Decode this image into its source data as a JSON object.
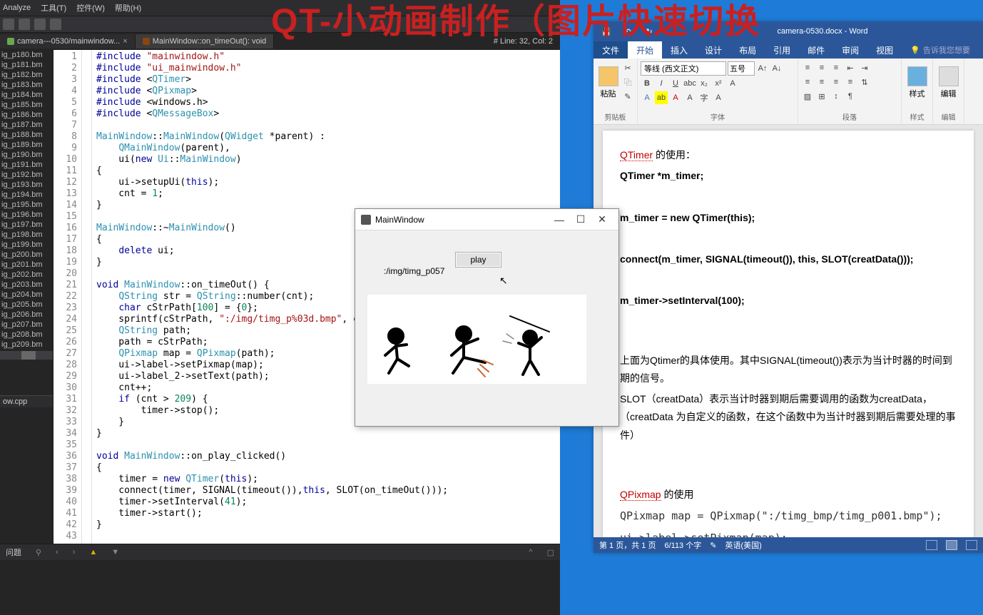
{
  "watermark": "QT-小动画制作（图片快速切换",
  "ide": {
    "menu": {
      "analyze": "Analyze",
      "tools": "工具(T)",
      "widgets": "控件(W)",
      "help": "帮助(H)"
    },
    "tabs": {
      "tab1": "camera---0530/mainwindow...",
      "tab2": "MainWindow::on_timeOut(): void",
      "status": "# Line: 32, Col: 2"
    },
    "sidebar_files": [
      "ig_p180.bm",
      "ig_p181.bm",
      "ig_p182.bm",
      "ig_p183.bm",
      "ig_p184.bm",
      "ig_p185.bm",
      "ig_p186.bm",
      "ig_p187.bm",
      "ig_p188.bm",
      "ig_p189.bm",
      "ig_p190.bm",
      "ig_p191.bm",
      "ig_p192.bm",
      "ig_p193.bm",
      "ig_p194.bm",
      "ig_p195.bm",
      "ig_p196.bm",
      "ig_p197.bm",
      "ig_p198.bm",
      "ig_p199.bm",
      "ig_p200.bm",
      "ig_p201.bm",
      "ig_p202.bm",
      "ig_p203.bm",
      "ig_p204.bm",
      "ig_p205.bm",
      "ig_p206.bm",
      "ig_p207.bm",
      "ig_p208.bm",
      "ig_p209.bm"
    ],
    "current_file": "ow.cpp",
    "code_lines": [
      {
        "n": 1,
        "t": "#include \"mainwindow.h\""
      },
      {
        "n": 2,
        "t": "#include \"ui_mainwindow.h\""
      },
      {
        "n": 3,
        "t": "#include <QTimer>"
      },
      {
        "n": 4,
        "t": "#include <QPixmap>"
      },
      {
        "n": 5,
        "t": "#include <windows.h>"
      },
      {
        "n": 6,
        "t": "#include <QMessageBox>"
      },
      {
        "n": 7,
        "t": ""
      },
      {
        "n": 8,
        "t": "MainWindow::MainWindow(QWidget *parent) :"
      },
      {
        "n": 9,
        "t": "    QMainWindow(parent),"
      },
      {
        "n": 10,
        "t": "    ui(new Ui::MainWindow)"
      },
      {
        "n": 11,
        "t": "{"
      },
      {
        "n": 12,
        "t": "    ui->setupUi(this);"
      },
      {
        "n": 13,
        "t": "    cnt = 1;"
      },
      {
        "n": 14,
        "t": "}"
      },
      {
        "n": 15,
        "t": ""
      },
      {
        "n": 16,
        "t": "MainWindow::~MainWindow()"
      },
      {
        "n": 17,
        "t": "{"
      },
      {
        "n": 18,
        "t": "    delete ui;"
      },
      {
        "n": 19,
        "t": "}"
      },
      {
        "n": 20,
        "t": ""
      },
      {
        "n": 21,
        "t": "void MainWindow::on_timeOut() {"
      },
      {
        "n": 22,
        "t": "    QString str = QString::number(cnt);"
      },
      {
        "n": 23,
        "t": "    char cStrPath[100] = {0};"
      },
      {
        "n": 24,
        "t": "    sprintf(cStrPath, \":/img/timg_p%03d.bmp\", cnt);"
      },
      {
        "n": 25,
        "t": "    QString path;"
      },
      {
        "n": 26,
        "t": "    path = cStrPath;"
      },
      {
        "n": 27,
        "t": "    QPixmap map = QPixmap(path);"
      },
      {
        "n": 28,
        "t": "    ui->label->setPixmap(map);"
      },
      {
        "n": 29,
        "t": "    ui->label_2->setText(path);"
      },
      {
        "n": 30,
        "t": "    cnt++;"
      },
      {
        "n": 31,
        "t": "    if (cnt > 209) {"
      },
      {
        "n": 32,
        "t": "        timer->stop();"
      },
      {
        "n": 33,
        "t": "    }"
      },
      {
        "n": 34,
        "t": "}"
      },
      {
        "n": 35,
        "t": ""
      },
      {
        "n": 36,
        "t": "void MainWindow::on_play_clicked()"
      },
      {
        "n": 37,
        "t": "{"
      },
      {
        "n": 38,
        "t": "    timer = new QTimer(this);"
      },
      {
        "n": 39,
        "t": "    connect(timer, SIGNAL(timeout()),this, SLOT(on_timeOut()));"
      },
      {
        "n": 40,
        "t": "    timer->setInterval(41);"
      },
      {
        "n": 41,
        "t": "    timer->start();"
      },
      {
        "n": 42,
        "t": "}"
      },
      {
        "n": 43,
        "t": ""
      }
    ],
    "problems_label": "问题"
  },
  "qt": {
    "title": "MainWindow",
    "play_btn": "play",
    "path_text": ":/img/timg_p057"
  },
  "word": {
    "title": "camera-0530.docx - Word",
    "tabs": {
      "file": "文件",
      "home": "开始",
      "insert": "插入",
      "design": "设计",
      "layout": "布局",
      "ref": "引用",
      "mail": "邮件",
      "review": "审阅",
      "view": "视图",
      "tell": "告诉我您想要"
    },
    "ribbon": {
      "clipboard_label": "剪贴板",
      "font_label": "字体",
      "paragraph_label": "段落",
      "styles_label": "样式",
      "editing_label": "编辑",
      "paste": "粘贴",
      "font_name": "等线 (西文正文)",
      "font_size": "五号"
    },
    "doc": {
      "l1a": "QTimer",
      "l1b": " 的使用：",
      "l2": "QTimer *m_timer;",
      "l3": "m_timer = new QTimer(this);",
      "l4": "connect(m_timer, SIGNAL(timeout()), this, SLOT(creatData()));",
      "l5": "m_timer->setInterval(100);",
      "l6": "上面为Qtimer的具体使用。其中SIGNAL(timeout())表示为当计时器的时间到期的信号。",
      "l7": "SLOT（creatData）表示当计时器到期后需要调用的函数为creatData，（creatData 为自定义的函数，在这个函数中为当计时器到期后需要处理的事件）",
      "l8a": "QPixmap",
      "l8b": " 的使用",
      "l9": "QPixmap map = QPixmap(\":/timg_bmp/timg_p001.bmp\");",
      "l10": "ui->label->setPixmap(map);"
    },
    "status": {
      "page": "第 1 页，共 1 页",
      "words": "6/113 个字",
      "lang": "英语(美国)"
    }
  }
}
